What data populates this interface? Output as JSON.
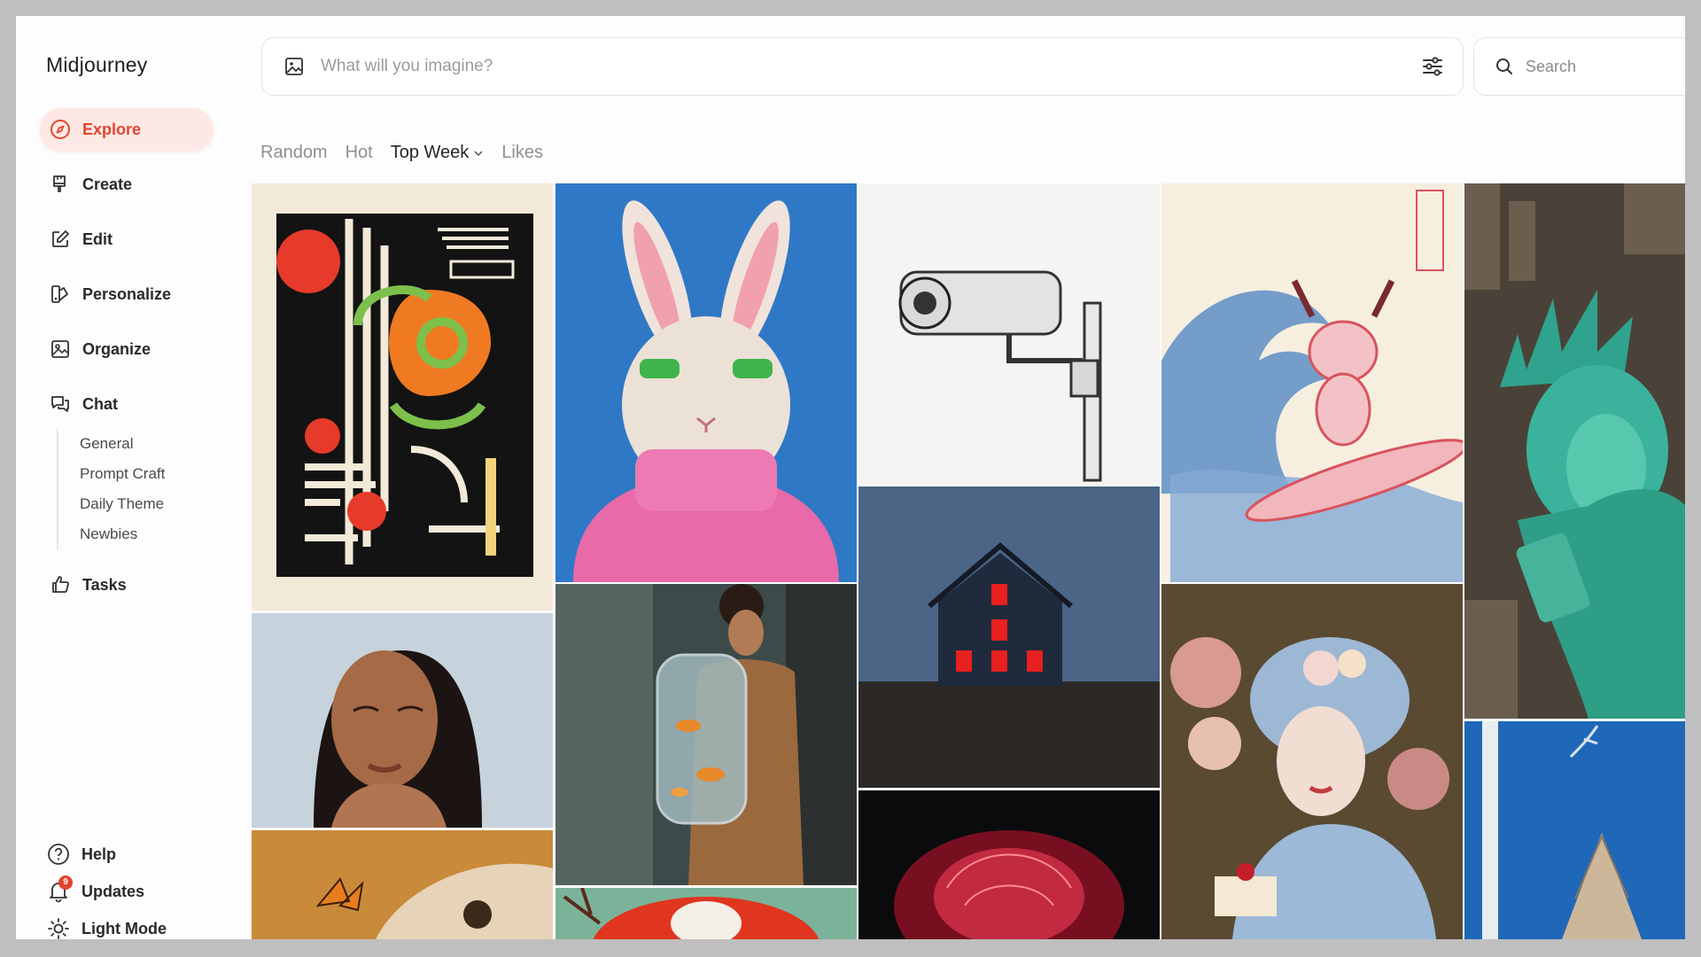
{
  "app": {
    "brand": "Midjourney"
  },
  "sidebar": {
    "items": [
      {
        "label": "Explore",
        "icon": "compass-icon"
      },
      {
        "label": "Create",
        "icon": "brush-icon"
      },
      {
        "label": "Edit",
        "icon": "pencil-square-icon"
      },
      {
        "label": "Personalize",
        "icon": "personalize-icon"
      },
      {
        "label": "Organize",
        "icon": "gallery-icon"
      },
      {
        "label": "Chat",
        "icon": "chat-bubbles-icon"
      }
    ],
    "chat_channels": [
      "General",
      "Prompt Craft",
      "Daily Theme",
      "Newbies"
    ],
    "tasks_label": "Tasks",
    "bottom": {
      "help_label": "Help",
      "updates_label": "Updates",
      "updates_badge": "9",
      "light_mode_label": "Light Mode"
    }
  },
  "prompt": {
    "placeholder": "What will you imagine?"
  },
  "search": {
    "placeholder": "Search"
  },
  "tabs": [
    {
      "label": "Random",
      "active": false
    },
    {
      "label": "Hot",
      "active": false
    },
    {
      "label": "Top Week",
      "active": true
    },
    {
      "label": "Likes",
      "active": false
    }
  ],
  "theme": {
    "accent": "#e2452f",
    "active_bg": "#fde8e5"
  },
  "gallery": [
    {
      "name": "abstract-pattern-poster"
    },
    {
      "name": "rabbit-in-pink-sweater"
    },
    {
      "name": "security-camera-sketch"
    },
    {
      "name": "cat-surfing-great-wave"
    },
    {
      "name": "statue-of-liberty-aerial"
    },
    {
      "name": "woman-portrait"
    },
    {
      "name": "man-with-fish-tank-backpack"
    },
    {
      "name": "house-red-windows-dusk"
    },
    {
      "name": "rococo-woman-flowers"
    },
    {
      "name": "fox-and-butterfly"
    },
    {
      "name": "crane-red-sun"
    },
    {
      "name": "glowing-red-rose"
    },
    {
      "name": "blue-tower-painting"
    }
  ]
}
